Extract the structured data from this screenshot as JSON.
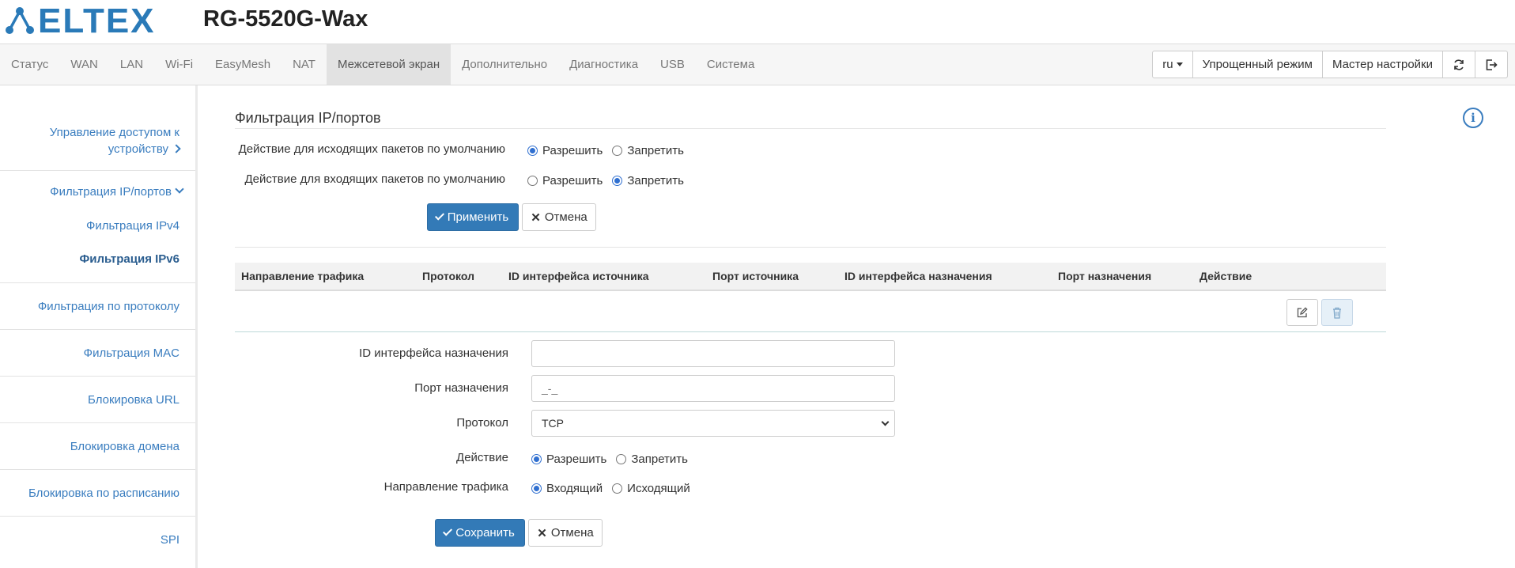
{
  "header": {
    "logo_text": "ELTEX",
    "model": "RG-5520G-Wax"
  },
  "nav": {
    "items": [
      "Статус",
      "WAN",
      "LAN",
      "Wi-Fi",
      "EasyMesh",
      "NAT",
      "Межсетевой экран",
      "Дополнительно",
      "Диагностика",
      "USB",
      "Система"
    ],
    "active": "Межсетевой экран",
    "lang": "ru",
    "simple_mode": "Упрощенный режим",
    "wizard": "Мастер настройки"
  },
  "sidebar": {
    "access_line1": "Управление доступом к",
    "access_line2": "устройству",
    "ip_filter": "Фильтрация IP/портов",
    "ipv4": "Фильтрация IPv4",
    "ipv6": "Фильтрация IPv6",
    "protocol": "Фильтрация по протоколу",
    "mac": "Фильтрация MAC",
    "url": "Блокировка URL",
    "domain": "Блокировка домена",
    "schedule": "Блокировка по расписанию",
    "spi": "SPI"
  },
  "page": {
    "title": "Фильтрация IP/портов",
    "outgoing_label": "Действие для исходящих пакетов по умолчанию",
    "incoming_label": "Действие для входящих пакетов по умолчанию",
    "allow": "Разрешить",
    "deny": "Запретить",
    "outgoing_value": "allow",
    "incoming_value": "deny",
    "apply": "Применить",
    "cancel": "Отмена"
  },
  "table": {
    "headers": [
      "Направление трафика",
      "Протокол",
      "ID интерфейса источника",
      "Порт источника",
      "ID интерфейса назначения",
      "Порт назначения",
      "Действие"
    ]
  },
  "form": {
    "dst_iface_label": "ID интерфейса назначения",
    "dst_iface_value": "",
    "dst_port_label": "Порт назначения",
    "dst_port_placeholder": "_-_",
    "protocol_label": "Протокол",
    "protocol_value": "TCP",
    "action_label": "Действие",
    "action_allow": "Разрешить",
    "action_deny": "Запретить",
    "direction_label": "Направление трафика",
    "direction_in": "Входящий",
    "direction_out": "Исходящий",
    "save": "Сохранить",
    "cancel": "Отмена"
  },
  "colors": {
    "brand": "#2a7ab8",
    "primary": "#337ab7",
    "link": "#3a7dbf"
  }
}
